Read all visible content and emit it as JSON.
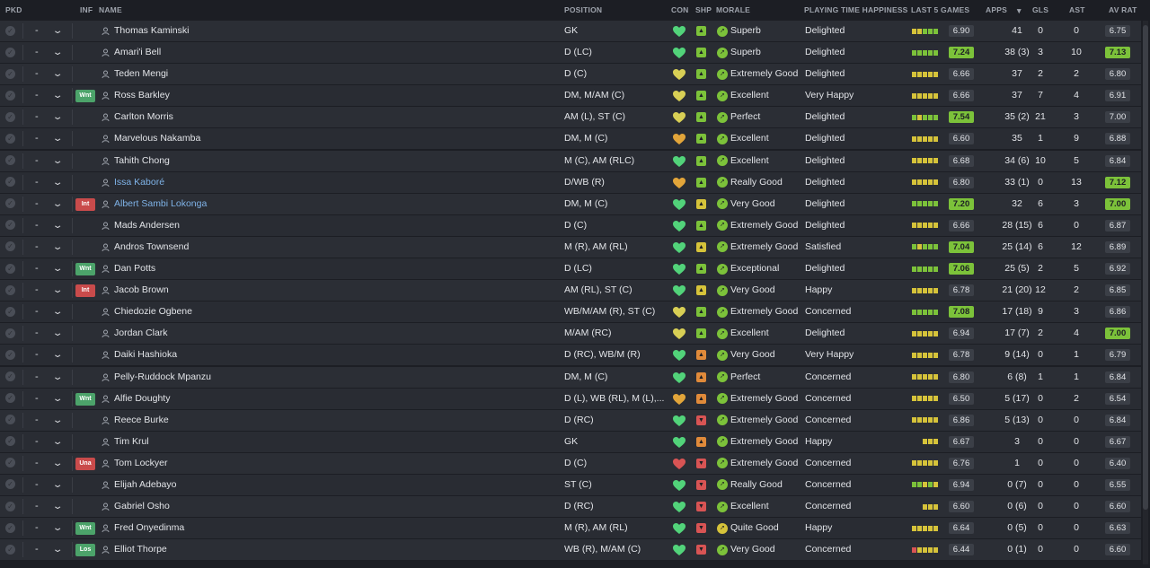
{
  "header": {
    "pkd": "PKD",
    "inf": "INF",
    "name": "NAME",
    "position": "POSITION",
    "con": "CON",
    "shp": "SHP",
    "morale": "MORALE",
    "pth": "PLAYING TIME HAPPINESS",
    "last5": "LAST 5 GAMES",
    "apps": "APPS",
    "sort_icon": "▼",
    "gls": "GLS",
    "ast": "AST",
    "avrat": "AV RAT"
  },
  "colors": {
    "green": "#7cc23a",
    "yellow": "#d6c33a",
    "orange": "#e08a3a",
    "red": "#d85454",
    "heart_green": "#52d37a",
    "heart_yellow": "#d8cf55",
    "heart_orange": "#e2a53a"
  },
  "rows": [
    {
      "dash": "-",
      "inf": "",
      "name": "Thomas Kaminski",
      "link": false,
      "pos": "GK",
      "con": "green",
      "shp": "green",
      "mor_icon": "green",
      "morale": "Superb",
      "pth": "Delighted",
      "l5": [
        "y",
        "y",
        "g",
        "g",
        "g"
      ],
      "l5v": "6.90",
      "l5hi": false,
      "apps": "41",
      "gls": "0",
      "ast": "0",
      "av": "6.75",
      "avhi": false
    },
    {
      "dash": "-",
      "inf": "",
      "name": "Amari'i Bell",
      "link": false,
      "pos": "D (LC)",
      "con": "green",
      "shp": "green",
      "mor_icon": "green",
      "morale": "Superb",
      "pth": "Delighted",
      "l5": [
        "g",
        "g",
        "g",
        "g",
        "g"
      ],
      "l5v": "7.24",
      "l5hi": true,
      "apps": "38 (3)",
      "gls": "3",
      "ast": "10",
      "av": "7.13",
      "avhi": true
    },
    {
      "dash": "-",
      "inf": "",
      "name": "Teden Mengi",
      "link": false,
      "pos": "D (C)",
      "con": "yellow",
      "shp": "green",
      "mor_icon": "green",
      "morale": "Extremely Good",
      "pth": "Delighted",
      "l5": [
        "y",
        "y",
        "y",
        "y",
        "y"
      ],
      "l5v": "6.66",
      "l5hi": false,
      "apps": "37",
      "gls": "2",
      "ast": "2",
      "av": "6.80",
      "avhi": false
    },
    {
      "dash": "-",
      "inf": "Wnt",
      "name": "Ross Barkley",
      "link": false,
      "pos": "DM, M/AM (C)",
      "con": "yellow",
      "shp": "green",
      "mor_icon": "green",
      "morale": "Excellent",
      "pth": "Very Happy",
      "l5": [
        "y",
        "y",
        "y",
        "y",
        "y"
      ],
      "l5v": "6.66",
      "l5hi": false,
      "apps": "37",
      "gls": "7",
      "ast": "4",
      "av": "6.91",
      "avhi": false
    },
    {
      "dash": "-",
      "inf": "",
      "name": "Carlton Morris",
      "link": false,
      "pos": "AM (L), ST (C)",
      "con": "yellow",
      "shp": "green",
      "mor_icon": "green",
      "morale": "Perfect",
      "pth": "Delighted",
      "l5": [
        "g",
        "y",
        "g",
        "g",
        "g"
      ],
      "l5v": "7.54",
      "l5hi": true,
      "apps": "35 (2)",
      "gls": "21",
      "ast": "3",
      "av": "7.00",
      "avhi": false
    },
    {
      "dash": "-",
      "inf": "",
      "name": "Marvelous Nakamba",
      "link": false,
      "pos": "DM, M (C)",
      "con": "orange",
      "shp": "green",
      "mor_icon": "green",
      "morale": "Excellent",
      "pth": "Delighted",
      "l5": [
        "y",
        "y",
        "y",
        "y",
        "y"
      ],
      "l5v": "6.60",
      "l5hi": false,
      "apps": "35",
      "gls": "1",
      "ast": "9",
      "av": "6.88",
      "avhi": false
    },
    {
      "dash": "-",
      "inf": "",
      "name": "Tahith Chong",
      "link": false,
      "pos": "M (C), AM (RLC)",
      "con": "green",
      "shp": "green",
      "mor_icon": "green",
      "morale": "Excellent",
      "pth": "Delighted",
      "l5": [
        "y",
        "y",
        "y",
        "y",
        "y"
      ],
      "l5v": "6.68",
      "l5hi": false,
      "apps": "34 (6)",
      "gls": "10",
      "ast": "5",
      "av": "6.84",
      "avhi": false
    },
    {
      "dash": "-",
      "inf": "",
      "name": "Issa Kaboré",
      "link": true,
      "pos": "D/WB (R)",
      "con": "orange",
      "shp": "green",
      "mor_icon": "green",
      "morale": "Really Good",
      "pth": "Delighted",
      "l5": [
        "y",
        "y",
        "y",
        "y",
        "y"
      ],
      "l5v": "6.80",
      "l5hi": false,
      "apps": "33 (1)",
      "gls": "0",
      "ast": "13",
      "av": "7.12",
      "avhi": true
    },
    {
      "dash": "-",
      "inf": "Int",
      "name": "Albert Sambi Lokonga",
      "link": true,
      "pos": "DM, M (C)",
      "con": "green",
      "shp": "yellow",
      "mor_icon": "green",
      "morale": "Very Good",
      "pth": "Delighted",
      "l5": [
        "g",
        "g",
        "g",
        "g",
        "g"
      ],
      "l5v": "7.20",
      "l5hi": true,
      "apps": "32",
      "gls": "6",
      "ast": "3",
      "av": "7.00",
      "avhi": true
    },
    {
      "dash": "-",
      "inf": "",
      "name": "Mads Andersen",
      "link": false,
      "pos": "D (C)",
      "con": "green",
      "shp": "green",
      "mor_icon": "green",
      "morale": "Extremely Good",
      "pth": "Delighted",
      "l5": [
        "y",
        "y",
        "y",
        "y",
        "y"
      ],
      "l5v": "6.66",
      "l5hi": false,
      "apps": "28 (15)",
      "gls": "6",
      "ast": "0",
      "av": "6.87",
      "avhi": false
    },
    {
      "dash": "-",
      "inf": "",
      "name": "Andros Townsend",
      "link": false,
      "pos": "M (R), AM (RL)",
      "con": "green",
      "shp": "yellow",
      "mor_icon": "green",
      "morale": "Extremely Good",
      "pth": "Satisfied",
      "l5": [
        "g",
        "y",
        "g",
        "g",
        "g"
      ],
      "l5v": "7.04",
      "l5hi": true,
      "apps": "25 (14)",
      "gls": "6",
      "ast": "12",
      "av": "6.89",
      "avhi": false
    },
    {
      "dash": "-",
      "inf": "Wnt",
      "name": "Dan Potts",
      "link": false,
      "pos": "D (LC)",
      "con": "green",
      "shp": "green",
      "mor_icon": "green",
      "morale": "Exceptional",
      "pth": "Delighted",
      "l5": [
        "g",
        "g",
        "g",
        "g",
        "g"
      ],
      "l5v": "7.06",
      "l5hi": true,
      "apps": "25 (5)",
      "gls": "2",
      "ast": "5",
      "av": "6.92",
      "avhi": false
    },
    {
      "dash": "-",
      "inf": "Int",
      "name": "Jacob Brown",
      "link": false,
      "pos": "AM (RL), ST (C)",
      "con": "green",
      "shp": "yellow",
      "mor_icon": "green",
      "morale": "Very Good",
      "pth": "Happy",
      "l5": [
        "y",
        "y",
        "y",
        "y",
        "y"
      ],
      "l5v": "6.78",
      "l5hi": false,
      "apps": "21 (20)",
      "gls": "12",
      "ast": "2",
      "av": "6.85",
      "avhi": false
    },
    {
      "dash": "-",
      "inf": "",
      "name": "Chiedozie Ogbene",
      "link": false,
      "pos": "WB/M/AM (R), ST (C)",
      "con": "yellow",
      "shp": "green",
      "mor_icon": "green",
      "morale": "Extremely Good",
      "pth": "Concerned",
      "l5": [
        "g",
        "g",
        "g",
        "g",
        "g"
      ],
      "l5v": "7.08",
      "l5hi": true,
      "apps": "17 (18)",
      "gls": "9",
      "ast": "3",
      "av": "6.86",
      "avhi": false
    },
    {
      "dash": "-",
      "inf": "",
      "name": "Jordan Clark",
      "link": false,
      "pos": "M/AM (RC)",
      "con": "yellow",
      "shp": "green",
      "mor_icon": "green",
      "morale": "Excellent",
      "pth": "Delighted",
      "l5": [
        "y",
        "y",
        "y",
        "y",
        "y"
      ],
      "l5v": "6.94",
      "l5hi": false,
      "apps": "17 (7)",
      "gls": "2",
      "ast": "4",
      "av": "7.00",
      "avhi": true
    },
    {
      "dash": "-",
      "inf": "",
      "name": "Daiki Hashioka",
      "link": false,
      "pos": "D (RC), WB/M (R)",
      "con": "green",
      "shp": "orange",
      "mor_icon": "green",
      "morale": "Very Good",
      "pth": "Very Happy",
      "l5": [
        "y",
        "y",
        "y",
        "y",
        "y"
      ],
      "l5v": "6.78",
      "l5hi": false,
      "apps": "9 (14)",
      "gls": "0",
      "ast": "1",
      "av": "6.79",
      "avhi": false
    },
    {
      "dash": "-",
      "inf": "",
      "name": "Pelly-Ruddock Mpanzu",
      "link": false,
      "pos": "DM, M (C)",
      "con": "green",
      "shp": "orange",
      "mor_icon": "green",
      "morale": "Perfect",
      "pth": "Concerned",
      "l5": [
        "y",
        "y",
        "y",
        "y",
        "y"
      ],
      "l5v": "6.80",
      "l5hi": false,
      "apps": "6 (8)",
      "gls": "1",
      "ast": "1",
      "av": "6.84",
      "avhi": false
    },
    {
      "dash": "-",
      "inf": "Wnt",
      "name": "Alfie Doughty",
      "link": false,
      "pos": "D (L), WB (RL), M (L),...",
      "con": "orange",
      "shp": "orange",
      "mor_icon": "green",
      "morale": "Extremely Good",
      "pth": "Concerned",
      "l5": [
        "y",
        "y",
        "y",
        "y",
        "y"
      ],
      "l5v": "6.50",
      "l5hi": false,
      "apps": "5 (17)",
      "gls": "0",
      "ast": "2",
      "av": "6.54",
      "avhi": false
    },
    {
      "dash": "-",
      "inf": "",
      "name": "Reece Burke",
      "link": false,
      "pos": "D (RC)",
      "con": "green",
      "shp": "red",
      "mor_icon": "green",
      "morale": "Extremely Good",
      "pth": "Concerned",
      "l5": [
        "y",
        "y",
        "y",
        "y",
        "y"
      ],
      "l5v": "6.86",
      "l5hi": false,
      "apps": "5 (13)",
      "gls": "0",
      "ast": "0",
      "av": "6.84",
      "avhi": false
    },
    {
      "dash": "-",
      "inf": "",
      "name": "Tim Krul",
      "link": false,
      "pos": "GK",
      "con": "green",
      "shp": "orange",
      "mor_icon": "green",
      "morale": "Extremely Good",
      "pth": "Happy",
      "l5": [
        "y",
        "y",
        "y"
      ],
      "l5v": "6.67",
      "l5hi": false,
      "apps": "3",
      "gls": "0",
      "ast": "0",
      "av": "6.67",
      "avhi": false
    },
    {
      "dash": "-",
      "inf": "Una",
      "name": "Tom Lockyer",
      "link": false,
      "pos": "D (C)",
      "con": "red",
      "shp": "red",
      "mor_icon": "green",
      "morale": "Extremely Good",
      "pth": "Concerned",
      "l5": [
        "y",
        "y",
        "y",
        "y",
        "y"
      ],
      "l5v": "6.76",
      "l5hi": false,
      "apps": "1",
      "gls": "0",
      "ast": "0",
      "av": "6.40",
      "avhi": false
    },
    {
      "dash": "-",
      "inf": "",
      "name": "Elijah Adebayo",
      "link": false,
      "pos": "ST (C)",
      "con": "green",
      "shp": "red",
      "mor_icon": "green",
      "morale": "Really Good",
      "pth": "Concerned",
      "l5": [
        "g",
        "g",
        "y",
        "g",
        "y"
      ],
      "l5v": "6.94",
      "l5hi": false,
      "apps": "0 (7)",
      "gls": "0",
      "ast": "0",
      "av": "6.55",
      "avhi": false
    },
    {
      "dash": "-",
      "inf": "",
      "name": "Gabriel Osho",
      "link": false,
      "pos": "D (RC)",
      "con": "green",
      "shp": "red",
      "mor_icon": "green",
      "morale": "Excellent",
      "pth": "Concerned",
      "l5": [
        "y",
        "y",
        "y"
      ],
      "l5v": "6.60",
      "l5hi": false,
      "apps": "0 (6)",
      "gls": "0",
      "ast": "0",
      "av": "6.60",
      "avhi": false
    },
    {
      "dash": "-",
      "inf": "Wnt",
      "name": "Fred Onyedinma",
      "link": false,
      "pos": "M (R), AM (RL)",
      "con": "green",
      "shp": "red",
      "mor_icon": "yellow",
      "morale": "Quite Good",
      "pth": "Happy",
      "l5": [
        "y",
        "y",
        "y",
        "y",
        "y"
      ],
      "l5v": "6.64",
      "l5hi": false,
      "apps": "0 (5)",
      "gls": "0",
      "ast": "0",
      "av": "6.63",
      "avhi": false
    },
    {
      "dash": "-",
      "inf": "Los",
      "name": "Elliot Thorpe",
      "link": false,
      "pos": "WB (R), M/AM (C)",
      "con": "green",
      "shp": "red",
      "mor_icon": "green",
      "morale": "Very Good",
      "pth": "Concerned",
      "l5": [
        "r",
        "y",
        "y",
        "y",
        "y"
      ],
      "l5v": "6.44",
      "l5hi": false,
      "apps": "0 (1)",
      "gls": "0",
      "ast": "0",
      "av": "6.60",
      "avhi": false
    }
  ]
}
